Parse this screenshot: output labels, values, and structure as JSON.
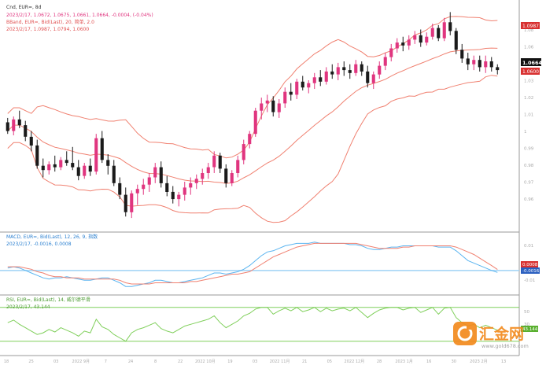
{
  "main": {
    "header_line1": "Cnd, EUR=, 8d",
    "header_ohlc": "2023/2/17, 1.0672, 1.0675, 1.0661, 1.0664, -0.0004, (-0.04%)",
    "bband_line1": "BBand, EUR=, Bid(Last), 20, 简单, 2.0",
    "bband_line2": "2023/2/17, 1.0987, 1.0794, 1.0600",
    "last_price": "1.0664",
    "band_upper_tag": "1.0987",
    "band_lower_tag": "1.0600",
    "y_ticks": [
      "1.08",
      "1.06",
      "1.04",
      "1.03",
      "1.02",
      "1.01",
      "1",
      "0.99",
      "0.98",
      "0.97",
      "0.96"
    ]
  },
  "macd": {
    "label1": "MACD, EUR=, Bid(Last), 12, 26, 9, 指数",
    "label2": "2023/2/17, -0.0016, 0.0008",
    "tag_red": "0.0008",
    "tag_blue": "-0.0016",
    "y_ticks": [
      "0.01",
      "0",
      "-0.01"
    ]
  },
  "rsi": {
    "label1": "RSI, EUR=, Bid(Last), 14, 威尔德平滑",
    "label2": "2023/2/17, 43.144",
    "tag": "43.144",
    "y_ticks": [
      "50",
      "30"
    ]
  },
  "xaxis": {
    "ticks": [
      "18",
      "25",
      "03",
      "2022 9月",
      "7",
      "24",
      "8",
      "22",
      "2022 10月",
      "19",
      "03",
      "2022 11月",
      "21",
      "05",
      "2022 12月",
      "28",
      "2023 1月",
      "16",
      "30",
      "2023 2月",
      "13"
    ]
  },
  "watermark": {
    "brand": "汇金网",
    "url": "www.gold678.com"
  },
  "colors": {
    "bull": "#e0357f",
    "bear": "#1a1a1a",
    "band": "#f08070",
    "macd": "#5ab4f0",
    "signal": "#f08070",
    "rsi": "#7fcf5a",
    "logo": "#f28a1e"
  },
  "chart_data": [
    {
      "type": "candlestick",
      "title": "Cnd, EUR=, 8d",
      "series": [
        {
          "name": "EUR=",
          "values": [
            [
              1.028,
              1.031,
              1.02,
              1.022
            ],
            [
              1.022,
              1.032,
              1.019,
              1.03
            ],
            [
              1.03,
              1.036,
              1.024,
              1.026
            ],
            [
              1.026,
              1.029,
              1.015,
              1.018
            ],
            [
              1.018,
              1.022,
              1.008,
              1.012
            ],
            [
              1.012,
              1.016,
              0.996,
              0.998
            ],
            [
              0.998,
              1.003,
              0.99,
              0.995
            ],
            [
              0.995,
              1.001,
              0.992,
              0.999
            ],
            [
              0.999,
              1.005,
              0.994,
              0.997
            ],
            [
              0.997,
              1.004,
              0.995,
              1.002
            ],
            [
              1.002,
              1.008,
              0.998,
              1.0
            ],
            [
              1.0,
              1.011,
              0.995,
              0.997
            ],
            [
              0.997,
              1.002,
              0.988,
              0.991
            ],
            [
              0.991,
              1.0,
              0.989,
              0.998
            ],
            [
              0.998,
              1.003,
              0.991,
              0.994
            ],
            [
              0.994,
              1.02,
              0.992,
              1.017
            ],
            [
              1.017,
              1.022,
              1.0,
              1.002
            ],
            [
              1.002,
              1.006,
              0.992,
              0.998
            ],
            [
              0.998,
              1.002,
              0.984,
              0.986
            ],
            [
              0.986,
              0.99,
              0.975,
              0.978
            ],
            [
              0.978,
              0.983,
              0.963,
              0.966
            ],
            [
              0.966,
              0.981,
              0.962,
              0.979
            ],
            [
              0.979,
              0.985,
              0.971,
              0.982
            ],
            [
              0.982,
              0.989,
              0.978,
              0.985
            ],
            [
              0.985,
              0.993,
              0.98,
              0.99
            ],
            [
              0.99,
              1.0,
              0.986,
              0.997
            ],
            [
              0.997,
              1.001,
              0.983,
              0.986
            ],
            [
              0.986,
              0.991,
              0.977,
              0.98
            ],
            [
              0.98,
              0.984,
              0.972,
              0.975
            ],
            [
              0.975,
              0.98,
              0.97,
              0.978
            ],
            [
              0.978,
              0.987,
              0.974,
              0.983
            ],
            [
              0.983,
              0.99,
              0.978,
              0.986
            ],
            [
              0.986,
              0.992,
              0.982,
              0.989
            ],
            [
              0.989,
              0.996,
              0.985,
              0.993
            ],
            [
              0.993,
              1.0,
              0.989,
              0.997
            ],
            [
              0.997,
              1.008,
              0.993,
              1.005
            ],
            [
              1.005,
              1.007,
              0.993,
              0.996
            ],
            [
              0.996,
              0.999,
              0.983,
              0.986
            ],
            [
              0.986,
              0.995,
              0.984,
              0.993
            ],
            [
              0.993,
              1.005,
              0.99,
              1.002
            ],
            [
              1.002,
              1.016,
              0.999,
              1.013
            ],
            [
              1.013,
              1.022,
              1.01,
              1.02
            ],
            [
              1.02,
              1.038,
              1.018,
              1.036
            ],
            [
              1.036,
              1.045,
              1.03,
              1.041
            ],
            [
              1.041,
              1.047,
              1.035,
              1.043
            ],
            [
              1.043,
              1.046,
              1.032,
              1.035
            ],
            [
              1.035,
              1.044,
              1.031,
              1.041
            ],
            [
              1.041,
              1.052,
              1.038,
              1.049
            ],
            [
              1.049,
              1.055,
              1.043,
              1.047
            ],
            [
              1.047,
              1.058,
              1.044,
              1.056
            ],
            [
              1.056,
              1.06,
              1.05,
              1.052
            ],
            [
              1.052,
              1.057,
              1.048,
              1.055
            ],
            [
              1.055,
              1.062,
              1.051,
              1.059
            ],
            [
              1.059,
              1.064,
              1.053,
              1.056
            ],
            [
              1.056,
              1.066,
              1.054,
              1.063
            ],
            [
              1.063,
              1.068,
              1.058,
              1.061
            ],
            [
              1.061,
              1.069,
              1.057,
              1.066
            ],
            [
              1.066,
              1.07,
              1.06,
              1.064
            ],
            [
              1.064,
              1.068,
              1.058,
              1.062
            ],
            [
              1.062,
              1.071,
              1.06,
              1.068
            ],
            [
              1.068,
              1.07,
              1.06,
              1.063
            ],
            [
              1.063,
              1.067,
              1.052,
              1.055
            ],
            [
              1.055,
              1.063,
              1.051,
              1.061
            ],
            [
              1.061,
              1.07,
              1.058,
              1.067
            ],
            [
              1.067,
              1.076,
              1.064,
              1.073
            ],
            [
              1.073,
              1.082,
              1.07,
              1.079
            ],
            [
              1.079,
              1.086,
              1.076,
              1.083
            ],
            [
              1.083,
              1.087,
              1.077,
              1.081
            ],
            [
              1.081,
              1.088,
              1.078,
              1.085
            ],
            [
              1.085,
              1.091,
              1.082,
              1.088
            ],
            [
              1.088,
              1.092,
              1.08,
              1.083
            ],
            [
              1.083,
              1.09,
              1.081,
              1.087
            ],
            [
              1.087,
              1.096,
              1.085,
              1.093
            ],
            [
              1.093,
              1.095,
              1.084,
              1.086
            ],
            [
              1.086,
              1.1,
              1.084,
              1.097
            ],
            [
              1.097,
              1.104,
              1.088,
              1.091
            ],
            [
              1.091,
              1.093,
              1.075,
              1.078
            ],
            [
              1.078,
              1.082,
              1.069,
              1.072
            ],
            [
              1.072,
              1.076,
              1.064,
              1.068
            ],
            [
              1.068,
              1.074,
              1.064,
              1.071
            ],
            [
              1.071,
              1.074,
              1.063,
              1.066
            ],
            [
              1.066,
              1.074,
              1.062,
              1.07
            ],
            [
              1.07,
              1.073,
              1.063,
              1.066
            ],
            [
              1.066,
              1.068,
              1.061,
              1.064
            ]
          ]
        }
      ],
      "bands": {
        "upper": 1.0987,
        "middle": 1.0794,
        "lower": 1.06,
        "period": 20,
        "dev": 2.0
      },
      "ylim": [
        0.955,
        1.108
      ],
      "ylabel": "",
      "grid": false
    },
    {
      "type": "line",
      "title": "MACD, EUR=, Bid(Last), 12, 26, 9, 指数",
      "series": [
        {
          "name": "MACD",
          "values": [
            0.002,
            0.003,
            0.002,
            0.0,
            -0.002,
            -0.004,
            -0.006,
            -0.007,
            -0.006,
            -0.006,
            -0.005,
            -0.006,
            -0.007,
            -0.008,
            -0.008,
            -0.007,
            -0.006,
            -0.006,
            -0.008,
            -0.01,
            -0.013,
            -0.013,
            -0.012,
            -0.011,
            -0.01,
            -0.008,
            -0.008,
            -0.009,
            -0.01,
            -0.01,
            -0.009,
            -0.008,
            -0.007,
            -0.006,
            -0.004,
            -0.002,
            -0.002,
            -0.003,
            -0.002,
            -0.001,
            0.001,
            0.004,
            0.008,
            0.012,
            0.015,
            0.016,
            0.018,
            0.02,
            0.021,
            0.022,
            0.022,
            0.022,
            0.023,
            0.022,
            0.022,
            0.022,
            0.022,
            0.022,
            0.021,
            0.021,
            0.02,
            0.018,
            0.017,
            0.017,
            0.018,
            0.019,
            0.019,
            0.02,
            0.02,
            0.02,
            0.02,
            0.02,
            0.02,
            0.019,
            0.019,
            0.019,
            0.016,
            0.012,
            0.008,
            0.006,
            0.004,
            0.002,
            0.0,
            -0.0016
          ]
        },
        {
          "name": "Signal",
          "values": [
            0.003,
            0.003,
            0.003,
            0.002,
            0.001,
            -0.001,
            -0.002,
            -0.004,
            -0.005,
            -0.005,
            -0.006,
            -0.006,
            -0.006,
            -0.007,
            -0.007,
            -0.007,
            -0.007,
            -0.007,
            -0.007,
            -0.008,
            -0.01,
            -0.011,
            -0.011,
            -0.011,
            -0.011,
            -0.01,
            -0.01,
            -0.01,
            -0.01,
            -0.01,
            -0.01,
            -0.009,
            -0.009,
            -0.008,
            -0.007,
            -0.006,
            -0.005,
            -0.004,
            -0.003,
            -0.003,
            -0.002,
            -0.001,
            0.002,
            0.005,
            0.008,
            0.011,
            0.013,
            0.015,
            0.017,
            0.019,
            0.02,
            0.021,
            0.022,
            0.022,
            0.022,
            0.022,
            0.022,
            0.022,
            0.022,
            0.022,
            0.021,
            0.02,
            0.019,
            0.018,
            0.018,
            0.018,
            0.018,
            0.019,
            0.019,
            0.02,
            0.02,
            0.02,
            0.02,
            0.02,
            0.02,
            0.02,
            0.019,
            0.017,
            0.015,
            0.013,
            0.01,
            0.007,
            0.004,
            0.0008
          ]
        }
      ],
      "ylim": [
        -0.018,
        0.028
      ]
    },
    {
      "type": "line",
      "title": "RSI, EUR=, Bid(Last), 14, 威尔德平滑",
      "series": [
        {
          "name": "RSI",
          "values": [
            52,
            55,
            50,
            46,
            42,
            38,
            40,
            44,
            41,
            46,
            43,
            40,
            36,
            42,
            40,
            56,
            47,
            44,
            38,
            34,
            30,
            40,
            44,
            46,
            49,
            52,
            45,
            42,
            40,
            44,
            48,
            50,
            52,
            54,
            56,
            60,
            52,
            46,
            50,
            54,
            60,
            63,
            68,
            70,
            70,
            62,
            66,
            69,
            66,
            70,
            65,
            67,
            70,
            65,
            69,
            66,
            68,
            69,
            66,
            70,
            64,
            58,
            63,
            67,
            69,
            70,
            70,
            67,
            69,
            70,
            64,
            67,
            70,
            62,
            69,
            70,
            58,
            52,
            48,
            50,
            46,
            49,
            46,
            43.144
          ]
        }
      ],
      "overbought": 70,
      "oversold": 30,
      "ylim": [
        15,
        80
      ]
    }
  ]
}
